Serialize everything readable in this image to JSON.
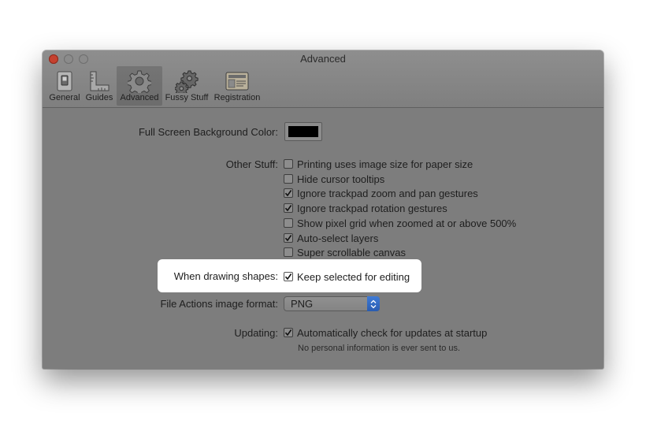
{
  "window": {
    "title": "Advanced"
  },
  "toolbar": {
    "tabs": [
      {
        "label": "General",
        "icon": "switch-icon"
      },
      {
        "label": "Guides",
        "icon": "ruler-icon"
      },
      {
        "label": "Advanced",
        "icon": "gear-icon",
        "selected": true
      },
      {
        "label": "Fussy Stuff",
        "icon": "gears-icon"
      },
      {
        "label": "Registration",
        "icon": "license-card-icon"
      }
    ]
  },
  "fullscreen": {
    "label": "Full Screen Background Color:",
    "color": "#000000"
  },
  "other_stuff": {
    "label": "Other Stuff:",
    "options": [
      {
        "text": "Printing uses image size for paper size",
        "checked": false
      },
      {
        "text": "Hide cursor tooltips",
        "checked": false
      },
      {
        "text": "Ignore trackpad zoom and pan gestures",
        "checked": true
      },
      {
        "text": "Ignore trackpad rotation gestures",
        "checked": true
      },
      {
        "text": "Show pixel grid when zoomed at or above 500%",
        "checked": false
      },
      {
        "text": "Auto-select layers",
        "checked": true
      },
      {
        "text": "Super scrollable canvas",
        "checked": false
      }
    ]
  },
  "drawing": {
    "label": "When drawing shapes:",
    "option": "Keep selected for editing",
    "checked": true
  },
  "file_actions": {
    "label": "File Actions image format:",
    "value": "PNG"
  },
  "updating": {
    "label": "Updating:",
    "option": "Automatically check for updates at startup",
    "checked": true,
    "note": "No personal information is ever sent to us."
  },
  "colors": {
    "accent": "#2f66c4",
    "close": "#c5412f",
    "highlight": "#ffffff"
  }
}
